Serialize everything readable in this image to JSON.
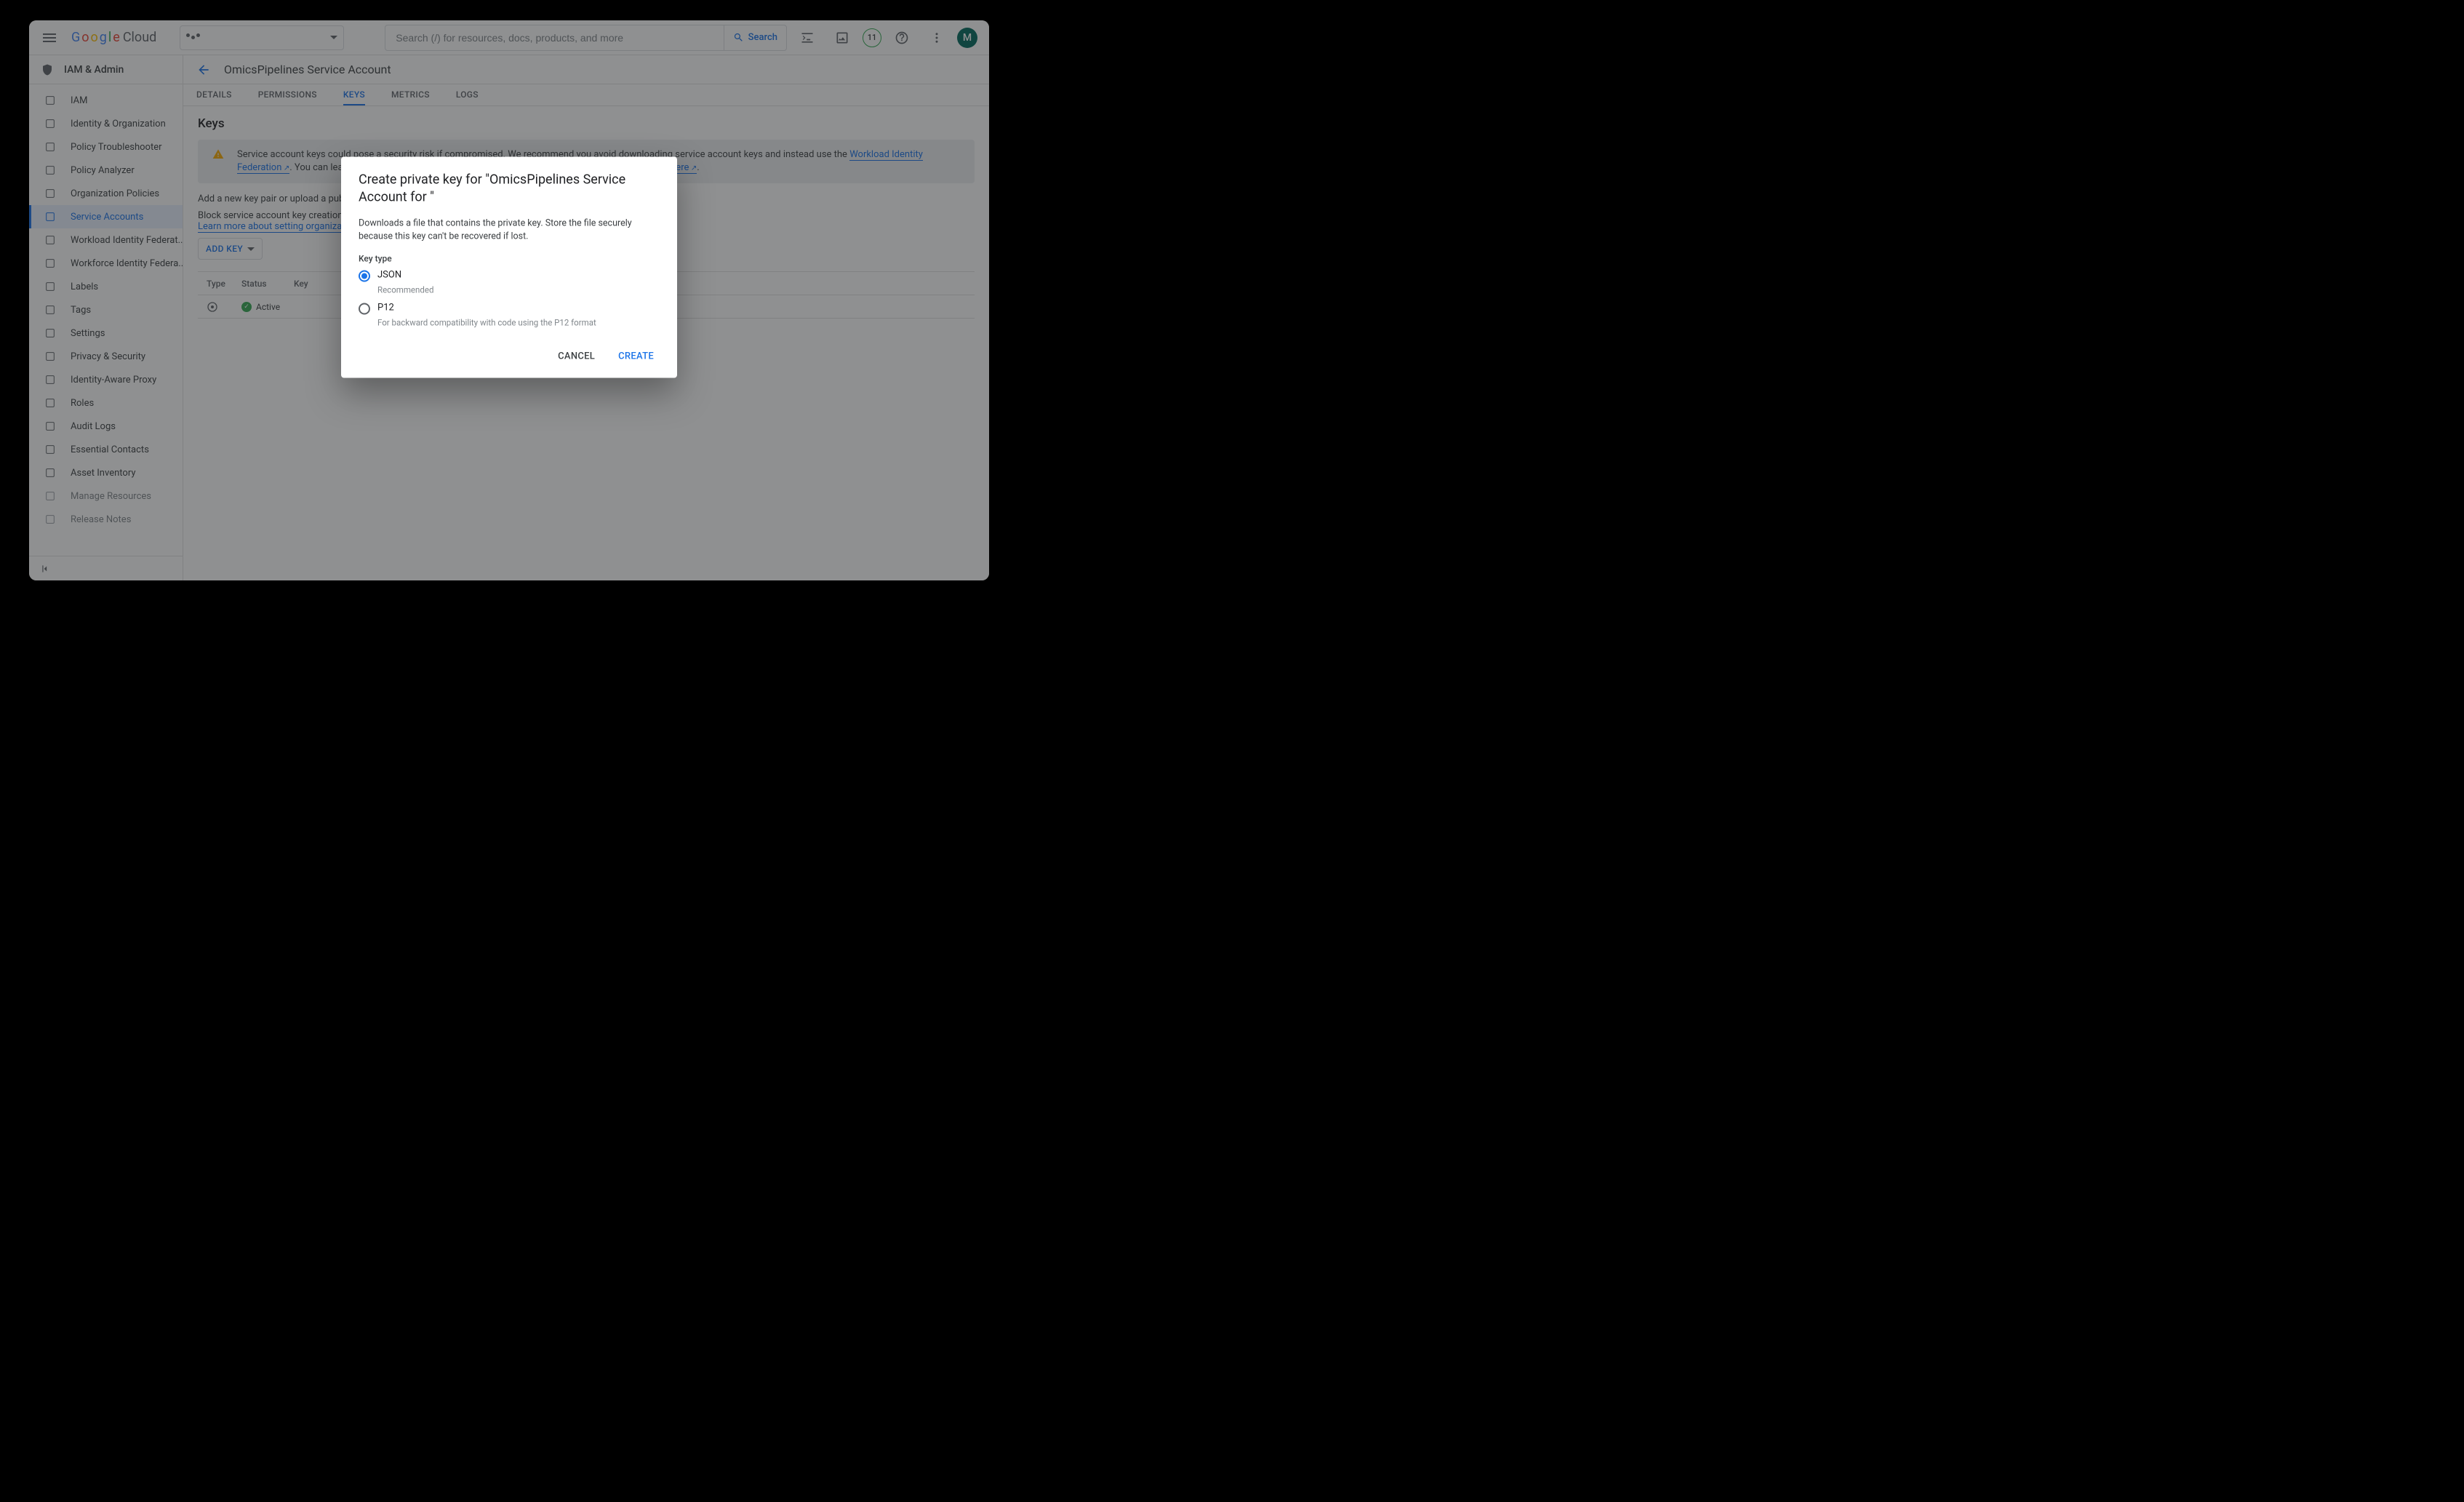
{
  "header": {
    "logo_cloud": "Cloud",
    "search_placeholder": "Search (/) for resources, docs, products, and more",
    "search_button": "Search",
    "notification_count": "11",
    "avatar_initial": "M"
  },
  "sidebar": {
    "section_title": "IAM & Admin",
    "items": [
      {
        "label": "IAM",
        "active": false
      },
      {
        "label": "Identity & Organization",
        "active": false
      },
      {
        "label": "Policy Troubleshooter",
        "active": false
      },
      {
        "label": "Policy Analyzer",
        "active": false
      },
      {
        "label": "Organization Policies",
        "active": false
      },
      {
        "label": "Service Accounts",
        "active": true
      },
      {
        "label": "Workload Identity Federat...",
        "active": false
      },
      {
        "label": "Workforce Identity Federa...",
        "active": false
      },
      {
        "label": "Labels",
        "active": false
      },
      {
        "label": "Tags",
        "active": false
      },
      {
        "label": "Settings",
        "active": false
      },
      {
        "label": "Privacy & Security",
        "active": false
      },
      {
        "label": "Identity-Aware Proxy",
        "active": false
      },
      {
        "label": "Roles",
        "active": false
      },
      {
        "label": "Audit Logs",
        "active": false
      },
      {
        "label": "Essential Contacts",
        "active": false
      },
      {
        "label": "Asset Inventory",
        "active": false
      },
      {
        "label": "Manage Resources",
        "active": false,
        "dim": true
      },
      {
        "label": "Release Notes",
        "active": false,
        "dim": true
      }
    ]
  },
  "page": {
    "title": "OmicsPipelines Service Account",
    "tabs": [
      {
        "label": "DETAILS"
      },
      {
        "label": "PERMISSIONS"
      },
      {
        "label": "KEYS",
        "active": true
      },
      {
        "label": "METRICS"
      },
      {
        "label": "LOGS"
      }
    ],
    "section_heading": "Keys",
    "warning_text_1": "Service account keys could pose a security risk if compromised. We recommend you avoid downloading service account keys and instead use the ",
    "warning_link_1": "Workload Identity Federation",
    "warning_text_2": ". You can learn more about the best way to authenticate service accounts on Google Cloud ",
    "warning_link_2": "here",
    "warning_text_3": ".",
    "desc1": "Add a new key pair or upload a public key",
    "desc2": "Block service account key creation using ",
    "desc3_link": "Learn more about setting organization po",
    "add_key_button": "ADD KEY",
    "table": {
      "col_type": "Type",
      "col_status": "Status",
      "col_key": "Key",
      "rows": [
        {
          "status": "Active"
        }
      ]
    }
  },
  "modal": {
    "title": "Create private key for \"OmicsPipelines Service Account for                                             \"",
    "body": "Downloads a file that contains the private key. Store the file securely because this key can't be recovered if lost.",
    "key_type_label": "Key type",
    "options": [
      {
        "label": "JSON",
        "help": "Recommended",
        "selected": true
      },
      {
        "label": "P12",
        "help": "For backward compatibility with code using the P12 format",
        "selected": false
      }
    ],
    "cancel": "CANCEL",
    "create": "CREATE"
  }
}
